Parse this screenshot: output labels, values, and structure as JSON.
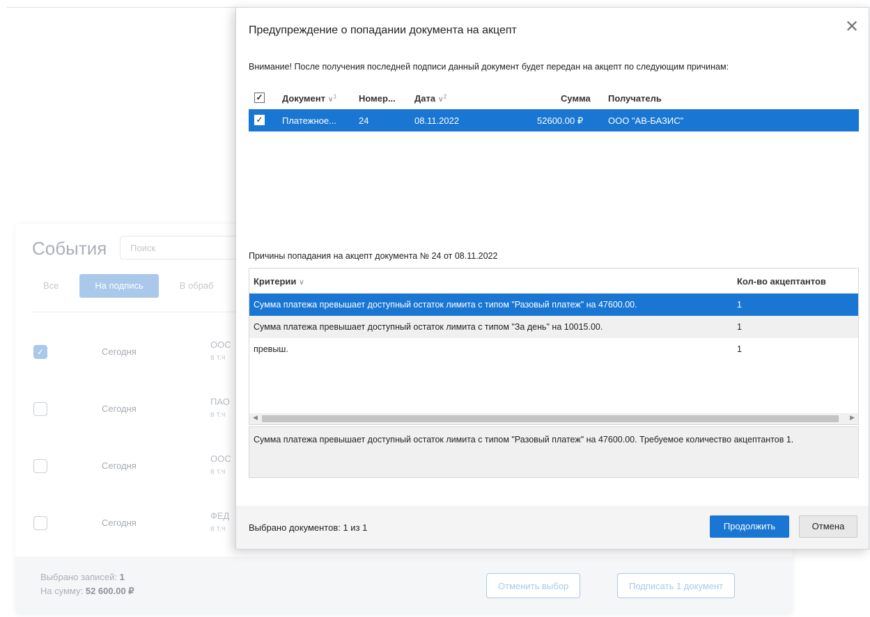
{
  "background": {
    "events_title": "События",
    "search_placeholder": "Поиск",
    "filters": [
      "Все",
      "На подпись",
      "В обраб"
    ],
    "rows": [
      {
        "checked": true,
        "date": "Сегодня",
        "org": "ООС",
        "sub": "в т.ч"
      },
      {
        "checked": false,
        "date": "Сегодня",
        "org": "ПАО",
        "sub": "в т.ч"
      },
      {
        "checked": false,
        "date": "Сегодня",
        "org": "ООС",
        "sub": "в т.ч"
      },
      {
        "checked": false,
        "date": "Сегодня",
        "org": "ФЕД",
        "sub": "в т.ч"
      }
    ],
    "footer": {
      "selected_label": "Выбрано записей:",
      "selected_value": "1",
      "sum_label": "На сумму:",
      "sum_value": "52 600.00 ₽",
      "cancel_selection": "Отменить выбор",
      "sign_button": "Подписать 1 документ"
    }
  },
  "modal": {
    "title": "Предупреждение о попадании документа на акцепт",
    "close_icon": "close-icon",
    "notice": "Внимание! После получения последней подписи данный документ будет передан на акцепт по следующим причинам:",
    "doc_columns": {
      "document": "Документ",
      "document_sort": "1",
      "number": "Номер...",
      "date": "Дата",
      "date_sort": "2",
      "sum": "Сумма",
      "recipient": "Получатель"
    },
    "doc_rows": [
      {
        "checked": true,
        "document": "Платежное...",
        "number": "24",
        "date": "08.11.2022",
        "sum": "52600.00 ₽",
        "recipient": "ООО \"АВ-БАЗИС\""
      }
    ],
    "reasons_title": "Причины попадания на акцепт документа № 24 от 08.11.2022",
    "reason_columns": {
      "criteria": "Критерии",
      "count": "Кол-во акцептантов"
    },
    "reasons": [
      {
        "criteria": "Сумма платежа превышает доступный остаток лимита с типом \"Разовый платеж\" на 47600.00.",
        "count": "1"
      },
      {
        "criteria": "Сумма платежа превышает доступный остаток лимита с типом \"За день\" на 10015.00.",
        "count": "1"
      },
      {
        "criteria": "превыш.",
        "count": "1"
      }
    ],
    "detail": "Сумма платежа превышает доступный остаток лимита с типом \"Разовый платеж\" на 47600.00. Требуемое количество акцептантов 1.",
    "selected_documents": "Выбрано документов: 1 из 1",
    "continue_button": "Продолжить",
    "cancel_button": "Отмена"
  }
}
